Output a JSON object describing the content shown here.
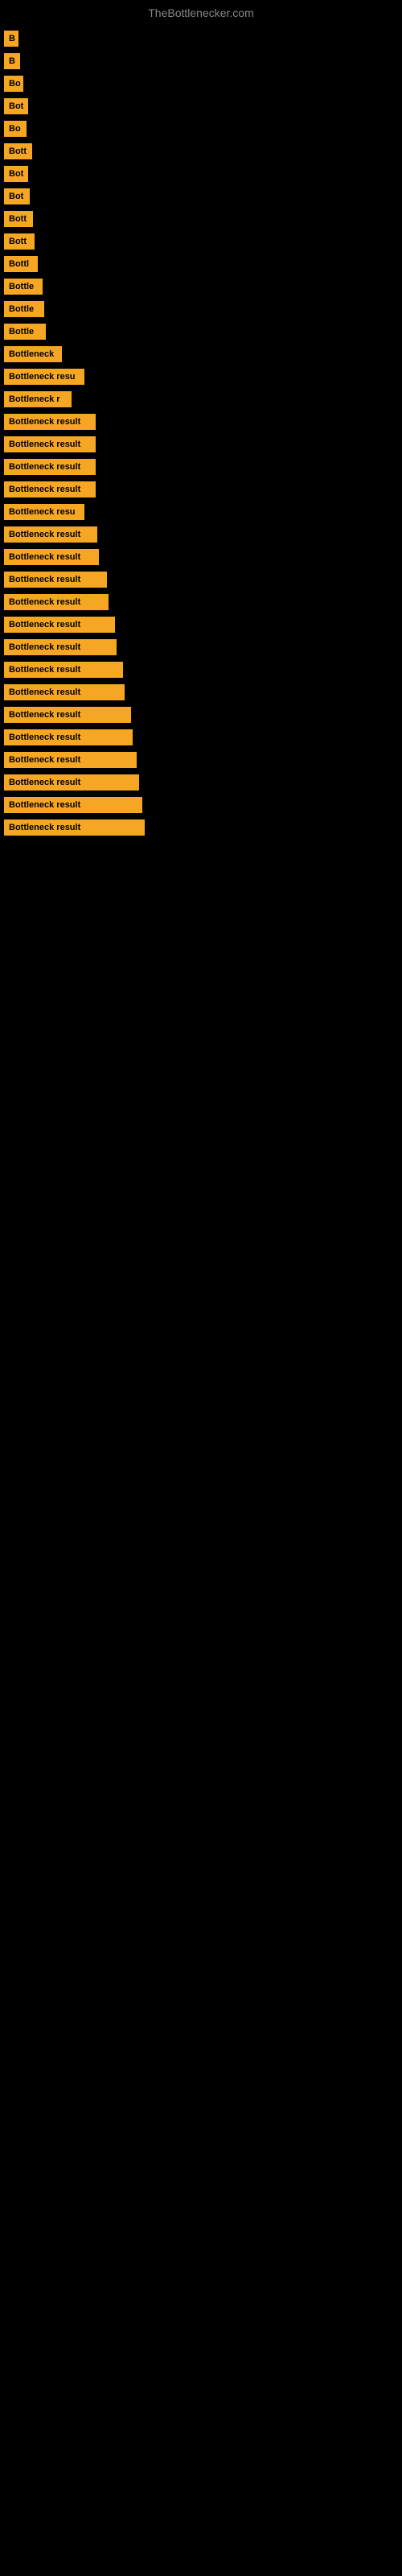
{
  "site": {
    "title": "TheBottlenecker.com"
  },
  "items": [
    {
      "id": 1,
      "label": "B",
      "width": 18
    },
    {
      "id": 2,
      "label": "B",
      "width": 20
    },
    {
      "id": 3,
      "label": "Bo",
      "width": 24
    },
    {
      "id": 4,
      "label": "Bot",
      "width": 30
    },
    {
      "id": 5,
      "label": "Bo",
      "width": 28
    },
    {
      "id": 6,
      "label": "Bott",
      "width": 35
    },
    {
      "id": 7,
      "label": "Bot",
      "width": 30
    },
    {
      "id": 8,
      "label": "Bot",
      "width": 32
    },
    {
      "id": 9,
      "label": "Bott",
      "width": 36
    },
    {
      "id": 10,
      "label": "Bott",
      "width": 38
    },
    {
      "id": 11,
      "label": "Bottl",
      "width": 42
    },
    {
      "id": 12,
      "label": "Bottle",
      "width": 48
    },
    {
      "id": 13,
      "label": "Bottle",
      "width": 50
    },
    {
      "id": 14,
      "label": "Bottle",
      "width": 52
    },
    {
      "id": 15,
      "label": "Bottleneck",
      "width": 72
    },
    {
      "id": 16,
      "label": "Bottleneck resu",
      "width": 100
    },
    {
      "id": 17,
      "label": "Bottleneck r",
      "width": 84
    },
    {
      "id": 18,
      "label": "Bottleneck result",
      "width": 114
    },
    {
      "id": 19,
      "label": "Bottleneck result",
      "width": 114
    },
    {
      "id": 20,
      "label": "Bottleneck result",
      "width": 114
    },
    {
      "id": 21,
      "label": "Bottleneck result",
      "width": 114
    },
    {
      "id": 22,
      "label": "Bottleneck resu",
      "width": 100
    },
    {
      "id": 23,
      "label": "Bottleneck result",
      "width": 116
    },
    {
      "id": 24,
      "label": "Bottleneck result",
      "width": 118
    },
    {
      "id": 25,
      "label": "Bottleneck result",
      "width": 128
    },
    {
      "id": 26,
      "label": "Bottleneck result",
      "width": 130
    },
    {
      "id": 27,
      "label": "Bottleneck result",
      "width": 138
    },
    {
      "id": 28,
      "label": "Bottleneck result",
      "width": 140
    },
    {
      "id": 29,
      "label": "Bottleneck result",
      "width": 148
    },
    {
      "id": 30,
      "label": "Bottleneck result",
      "width": 150
    },
    {
      "id": 31,
      "label": "Bottleneck result",
      "width": 158
    },
    {
      "id": 32,
      "label": "Bottleneck result",
      "width": 160
    },
    {
      "id": 33,
      "label": "Bottleneck result",
      "width": 165
    },
    {
      "id": 34,
      "label": "Bottleneck result",
      "width": 168
    },
    {
      "id": 35,
      "label": "Bottleneck result",
      "width": 172
    },
    {
      "id": 36,
      "label": "Bottleneck result",
      "width": 175
    }
  ]
}
